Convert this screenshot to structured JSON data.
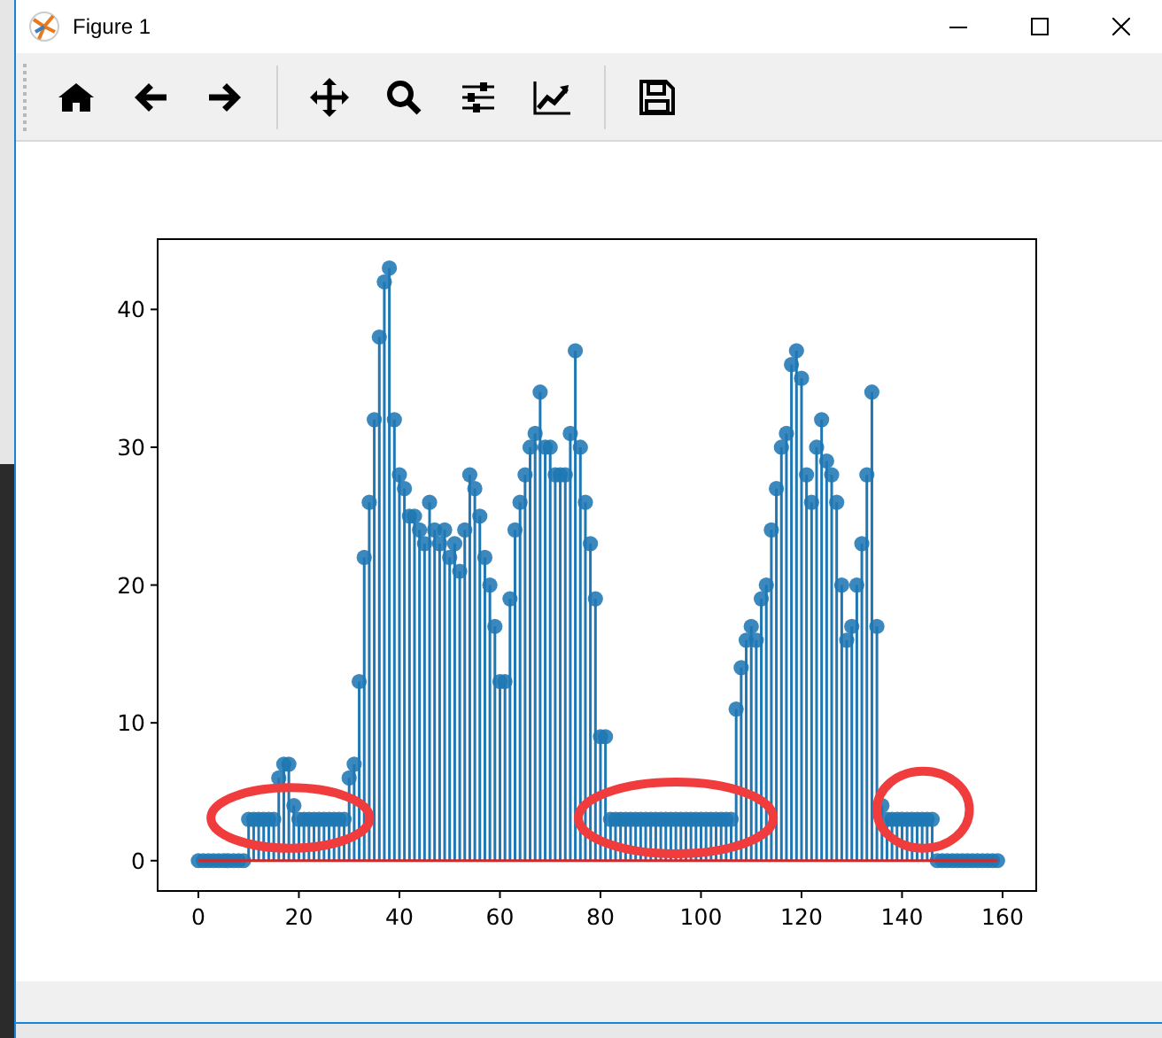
{
  "window": {
    "title": "Figure 1"
  },
  "figure": {
    "chart_data": {
      "type": "bar",
      "x": [
        0,
        1,
        2,
        3,
        4,
        5,
        6,
        7,
        8,
        9,
        10,
        11,
        12,
        13,
        14,
        15,
        16,
        17,
        18,
        19,
        20,
        21,
        22,
        23,
        24,
        25,
        26,
        27,
        28,
        29,
        30,
        31,
        32,
        33,
        34,
        35,
        36,
        37,
        38,
        39,
        40,
        41,
        42,
        43,
        44,
        45,
        46,
        47,
        48,
        49,
        50,
        51,
        52,
        53,
        54,
        55,
        56,
        57,
        58,
        59,
        60,
        61,
        62,
        63,
        64,
        65,
        66,
        67,
        68,
        69,
        70,
        71,
        72,
        73,
        74,
        75,
        76,
        77,
        78,
        79,
        80,
        81,
        82,
        83,
        84,
        85,
        86,
        87,
        88,
        89,
        90,
        91,
        92,
        93,
        94,
        95,
        96,
        97,
        98,
        99,
        100,
        101,
        102,
        103,
        104,
        105,
        106,
        107,
        108,
        109,
        110,
        111,
        112,
        113,
        114,
        115,
        116,
        117,
        118,
        119,
        120,
        121,
        122,
        123,
        124,
        125,
        126,
        127,
        128,
        129,
        130,
        131,
        132,
        133,
        134,
        135,
        136,
        137,
        138,
        139,
        140,
        141,
        142,
        143,
        144,
        145,
        146,
        147,
        148,
        149,
        150,
        151,
        152,
        153,
        154,
        155,
        156,
        157,
        158,
        159
      ],
      "series": [
        {
          "color": "#1f77b4",
          "values": [
            0,
            0,
            0,
            0,
            0,
            0,
            0,
            0,
            0,
            0,
            3,
            3,
            3,
            3,
            3,
            3,
            6,
            7,
            7,
            4,
            3,
            3,
            3,
            3,
            3,
            3,
            3,
            3,
            3,
            3,
            6,
            7,
            13,
            22,
            26,
            32,
            38,
            42,
            43,
            32,
            28,
            27,
            25,
            25,
            24,
            23,
            26,
            24,
            23,
            24,
            22,
            23,
            21,
            24,
            28,
            27,
            25,
            22,
            20,
            17,
            13,
            13,
            19,
            24,
            26,
            28,
            30,
            31,
            34,
            30,
            30,
            28,
            28,
            28,
            31,
            37,
            30,
            26,
            23,
            19,
            9,
            9,
            3,
            3,
            3,
            3,
            3,
            3,
            3,
            3,
            3,
            3,
            3,
            3,
            3,
            3,
            3,
            3,
            3,
            3,
            3,
            3,
            3,
            3,
            3,
            3,
            3,
            11,
            14,
            16,
            17,
            16,
            19,
            20,
            24,
            27,
            30,
            31,
            36,
            37,
            35,
            28,
            26,
            30,
            32,
            29,
            28,
            26,
            20,
            16,
            17,
            20,
            23,
            28,
            34,
            17,
            4,
            3,
            3,
            3,
            3,
            3,
            3,
            3,
            3,
            3,
            3,
            0,
            0,
            0,
            0,
            0,
            0,
            0,
            0,
            0,
            0,
            0,
            0,
            0
          ]
        }
      ],
      "xlim": [
        -8.1,
        166.7
      ],
      "ylim": [
        -2.2,
        45.1
      ],
      "xticks": [
        0,
        20,
        40,
        60,
        80,
        100,
        120,
        140,
        160
      ],
      "yticks": [
        0,
        10,
        20,
        30,
        40
      ],
      "ref_lines": [
        {
          "axis": "y",
          "value": 0,
          "color": "#d62728"
        }
      ]
    }
  }
}
